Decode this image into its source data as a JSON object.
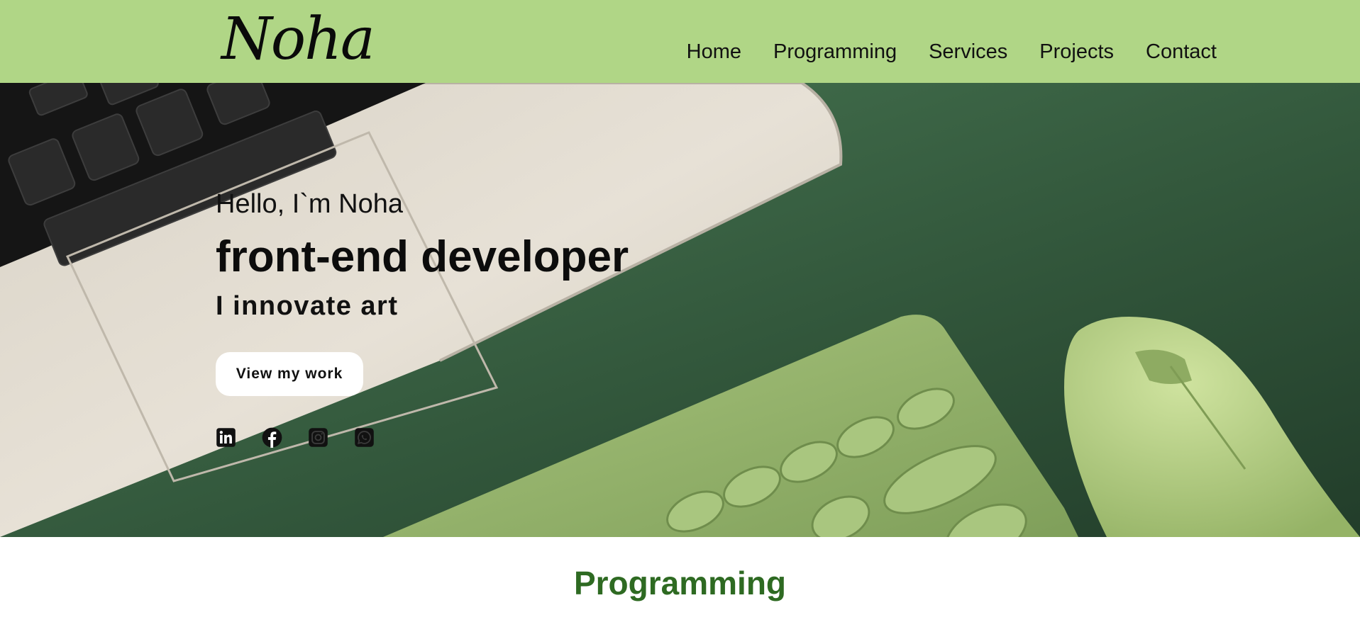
{
  "header": {
    "logo": "Noha",
    "nav": [
      "Home",
      "Programming",
      "Services",
      "Projects",
      "Contact"
    ]
  },
  "hero": {
    "greeting": "Hello, I`m Noha",
    "title": "front-end developer",
    "subtitle": "I innovate art",
    "cta_label": "View my work",
    "socials": [
      "linkedin-icon",
      "facebook-icon",
      "instagram-icon",
      "whatsapp-icon"
    ]
  },
  "section": {
    "title": "Programming"
  },
  "colors": {
    "header_bg": "#b0d686",
    "section_title": "#2e6a22",
    "hero_bg": "#2f5a3a"
  }
}
